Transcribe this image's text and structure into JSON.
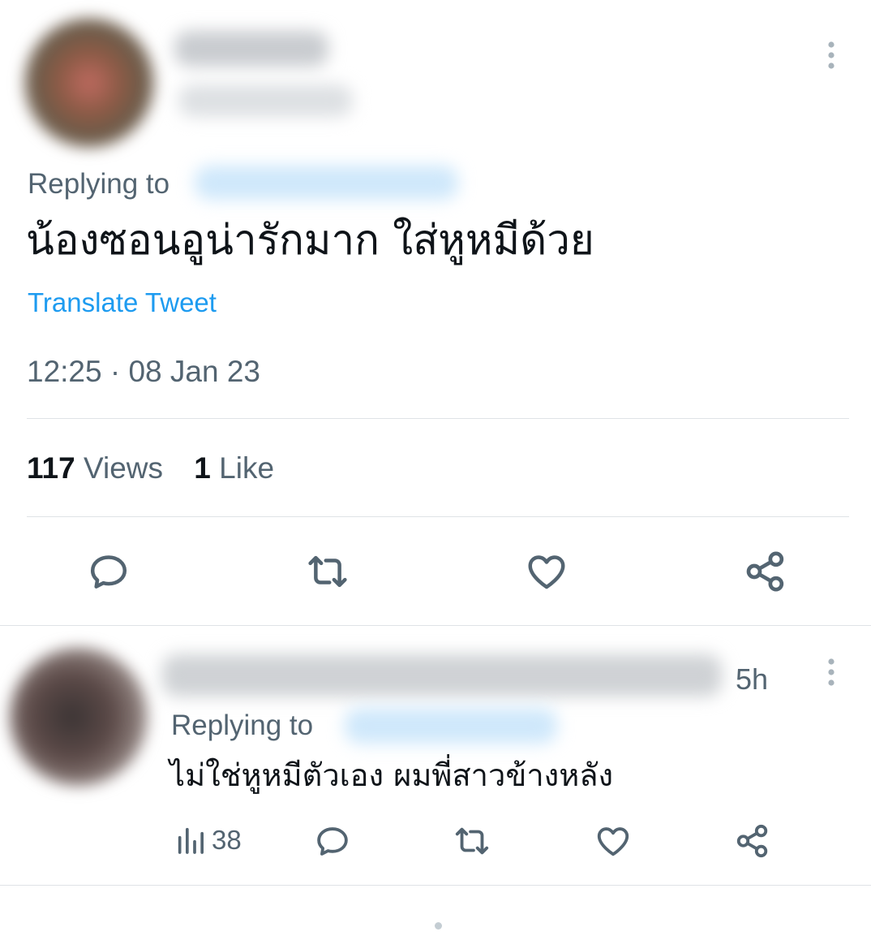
{
  "main_tweet": {
    "replying_label": "Replying to",
    "text": "น้องซอนอูน่ารักมาก ใส่หูหมีด้วย",
    "translate_label": "Translate Tweet",
    "timestamp": "12:25 · 08 Jan 23",
    "views_count": "117",
    "views_label": "Views",
    "likes_count": "1",
    "likes_label": "Like",
    "actions": [
      "reply-icon",
      "retweet-icon",
      "like-icon",
      "share-icon"
    ]
  },
  "reply": {
    "time_ago": "5h",
    "replying_label": "Replying to",
    "text": "ไม่ใช่หูหมีตัวเอง ผมพี่สาวข้างหลัง",
    "views_count": "38",
    "actions": [
      "views-icon",
      "reply-icon",
      "retweet-icon",
      "like-icon",
      "share-icon"
    ]
  },
  "colors": {
    "text": "#0f1419",
    "muted": "#536471",
    "accent": "#1d9bf0",
    "divider": "#dfe3e6"
  }
}
